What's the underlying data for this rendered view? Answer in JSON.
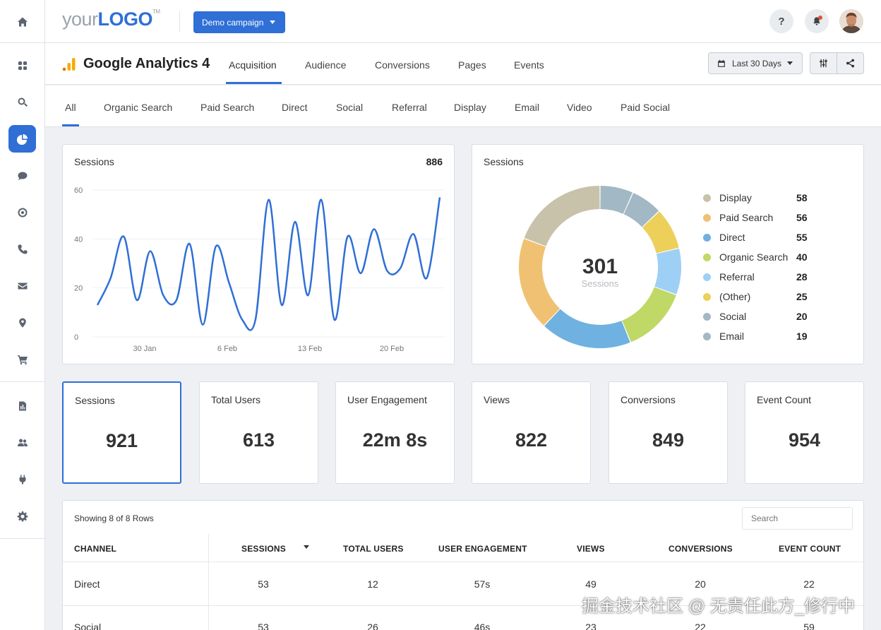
{
  "header": {
    "logo_your": "your",
    "logo_brand": "LOGO",
    "logo_tm": "TM",
    "campaign_label": "Demo campaign",
    "help_label": "?"
  },
  "subheader": {
    "title": "Google Analytics 4",
    "tabs": [
      {
        "label": "Acquisition",
        "active": true
      },
      {
        "label": "Audience"
      },
      {
        "label": "Conversions"
      },
      {
        "label": "Pages"
      },
      {
        "label": "Events"
      }
    ],
    "date_range": "Last 30 Days"
  },
  "channel_tabs": [
    "All",
    "Organic Search",
    "Paid Search",
    "Direct",
    "Social",
    "Referral",
    "Display",
    "Email",
    "Video",
    "Paid Social"
  ],
  "line_card": {
    "title": "Sessions",
    "total": "886"
  },
  "donut_card": {
    "title": "Sessions",
    "center_value": "301",
    "center_label": "Sessions",
    "legend": [
      {
        "label": "Display",
        "value": "58",
        "color": "#c8c2aa"
      },
      {
        "label": "Paid Search",
        "value": "56",
        "color": "#f0c173"
      },
      {
        "label": "Direct",
        "value": "55",
        "color": "#6fb1e0"
      },
      {
        "label": "Organic Search",
        "value": "40",
        "color": "#bfd866"
      },
      {
        "label": "Referral",
        "value": "28",
        "color": "#9ed0f5"
      },
      {
        "label": "(Other)",
        "value": "25",
        "color": "#ecd05a"
      },
      {
        "label": "Social",
        "value": "20",
        "color": "#a2b8c4"
      },
      {
        "label": "Email",
        "value": "19",
        "color": "#a2b8c4"
      }
    ]
  },
  "chart_data": [
    {
      "type": "line",
      "title": "Sessions",
      "x_ticks": [
        "30 Jan",
        "6 Feb",
        "13 Feb",
        "20 Feb"
      ],
      "y_ticks": [
        "60",
        "40",
        "20",
        "0"
      ],
      "ylim": [
        0,
        60
      ],
      "grid": true,
      "series": [
        {
          "values": [
            13,
            24,
            41,
            15,
            35,
            17,
            15,
            38,
            5,
            37,
            22,
            7,
            7,
            56,
            13,
            47,
            17,
            56,
            7,
            41,
            26,
            44,
            27,
            28,
            42,
            24,
            57
          ]
        }
      ]
    },
    {
      "type": "pie",
      "title": "Sessions",
      "categories": [
        "Display",
        "Paid Search",
        "Direct",
        "Organic Search",
        "Referral",
        "(Other)",
        "Social",
        "Email"
      ],
      "values": [
        58,
        56,
        55,
        40,
        28,
        25,
        20,
        19
      ],
      "total": 301
    }
  ],
  "kpis": [
    {
      "label": "Sessions",
      "value": "921",
      "active": true
    },
    {
      "label": "Total Users",
      "value": "613"
    },
    {
      "label": "User Engagement",
      "value": "22m 8s"
    },
    {
      "label": "Views",
      "value": "822"
    },
    {
      "label": "Conversions",
      "value": "849"
    },
    {
      "label": "Event Count",
      "value": "954"
    }
  ],
  "table": {
    "showing": "Showing 8 of 8 Rows",
    "search_placeholder": "Search",
    "columns": [
      "CHANNEL",
      "SESSIONS",
      "TOTAL USERS",
      "USER ENGAGEMENT",
      "VIEWS",
      "CONVERSIONS",
      "EVENT COUNT"
    ],
    "rows": [
      [
        "Direct",
        "53",
        "12",
        "57s",
        "49",
        "20",
        "22"
      ],
      [
        "Social",
        "53",
        "26",
        "46s",
        "23",
        "22",
        "59"
      ]
    ]
  },
  "watermark": "掘金技术社区 @ 无责任此方_修行中",
  "colors": {
    "accent": "#2f6fd6",
    "line": "#2f6fd6"
  }
}
